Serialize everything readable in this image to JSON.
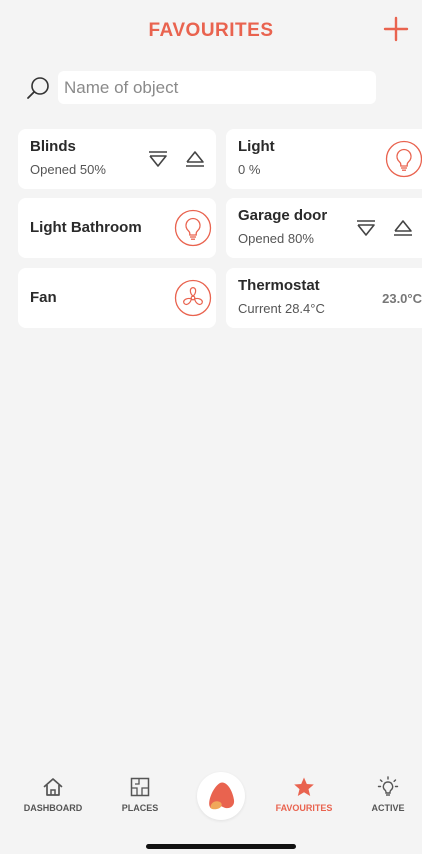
{
  "header": {
    "title": "FAVOURITES",
    "add_icon": "plus-icon"
  },
  "search": {
    "placeholder": "Name of object",
    "value": "",
    "icon": "search-icon"
  },
  "colors": {
    "accent": "#e9634f",
    "background": "#f4f4f4",
    "card": "#ffffff"
  },
  "cards": {
    "blinds": {
      "name": "Blinds",
      "status": "Opened 50%"
    },
    "light": {
      "name": "Light",
      "status": "0 %"
    },
    "light_bathroom": {
      "name": "Light Bathroom"
    },
    "garage_door": {
      "name": "Garage door",
      "status": "Opened 80%"
    },
    "fan": {
      "name": "Fan"
    },
    "thermostat": {
      "name": "Thermostat",
      "status": "Current 28.4°C",
      "setpoint": "23.0°C"
    }
  },
  "nav": {
    "items": [
      {
        "label": "DASHBOARD",
        "icon": "home-icon",
        "active": false
      },
      {
        "label": "PLACES",
        "icon": "floorplan-icon",
        "active": false
      },
      {
        "label": "FAVOURITES",
        "icon": "star-icon",
        "active": true
      },
      {
        "label": "ACTIVE",
        "icon": "lightbulb-icon",
        "active": false
      }
    ],
    "center_icon": "app-logo-icon"
  }
}
